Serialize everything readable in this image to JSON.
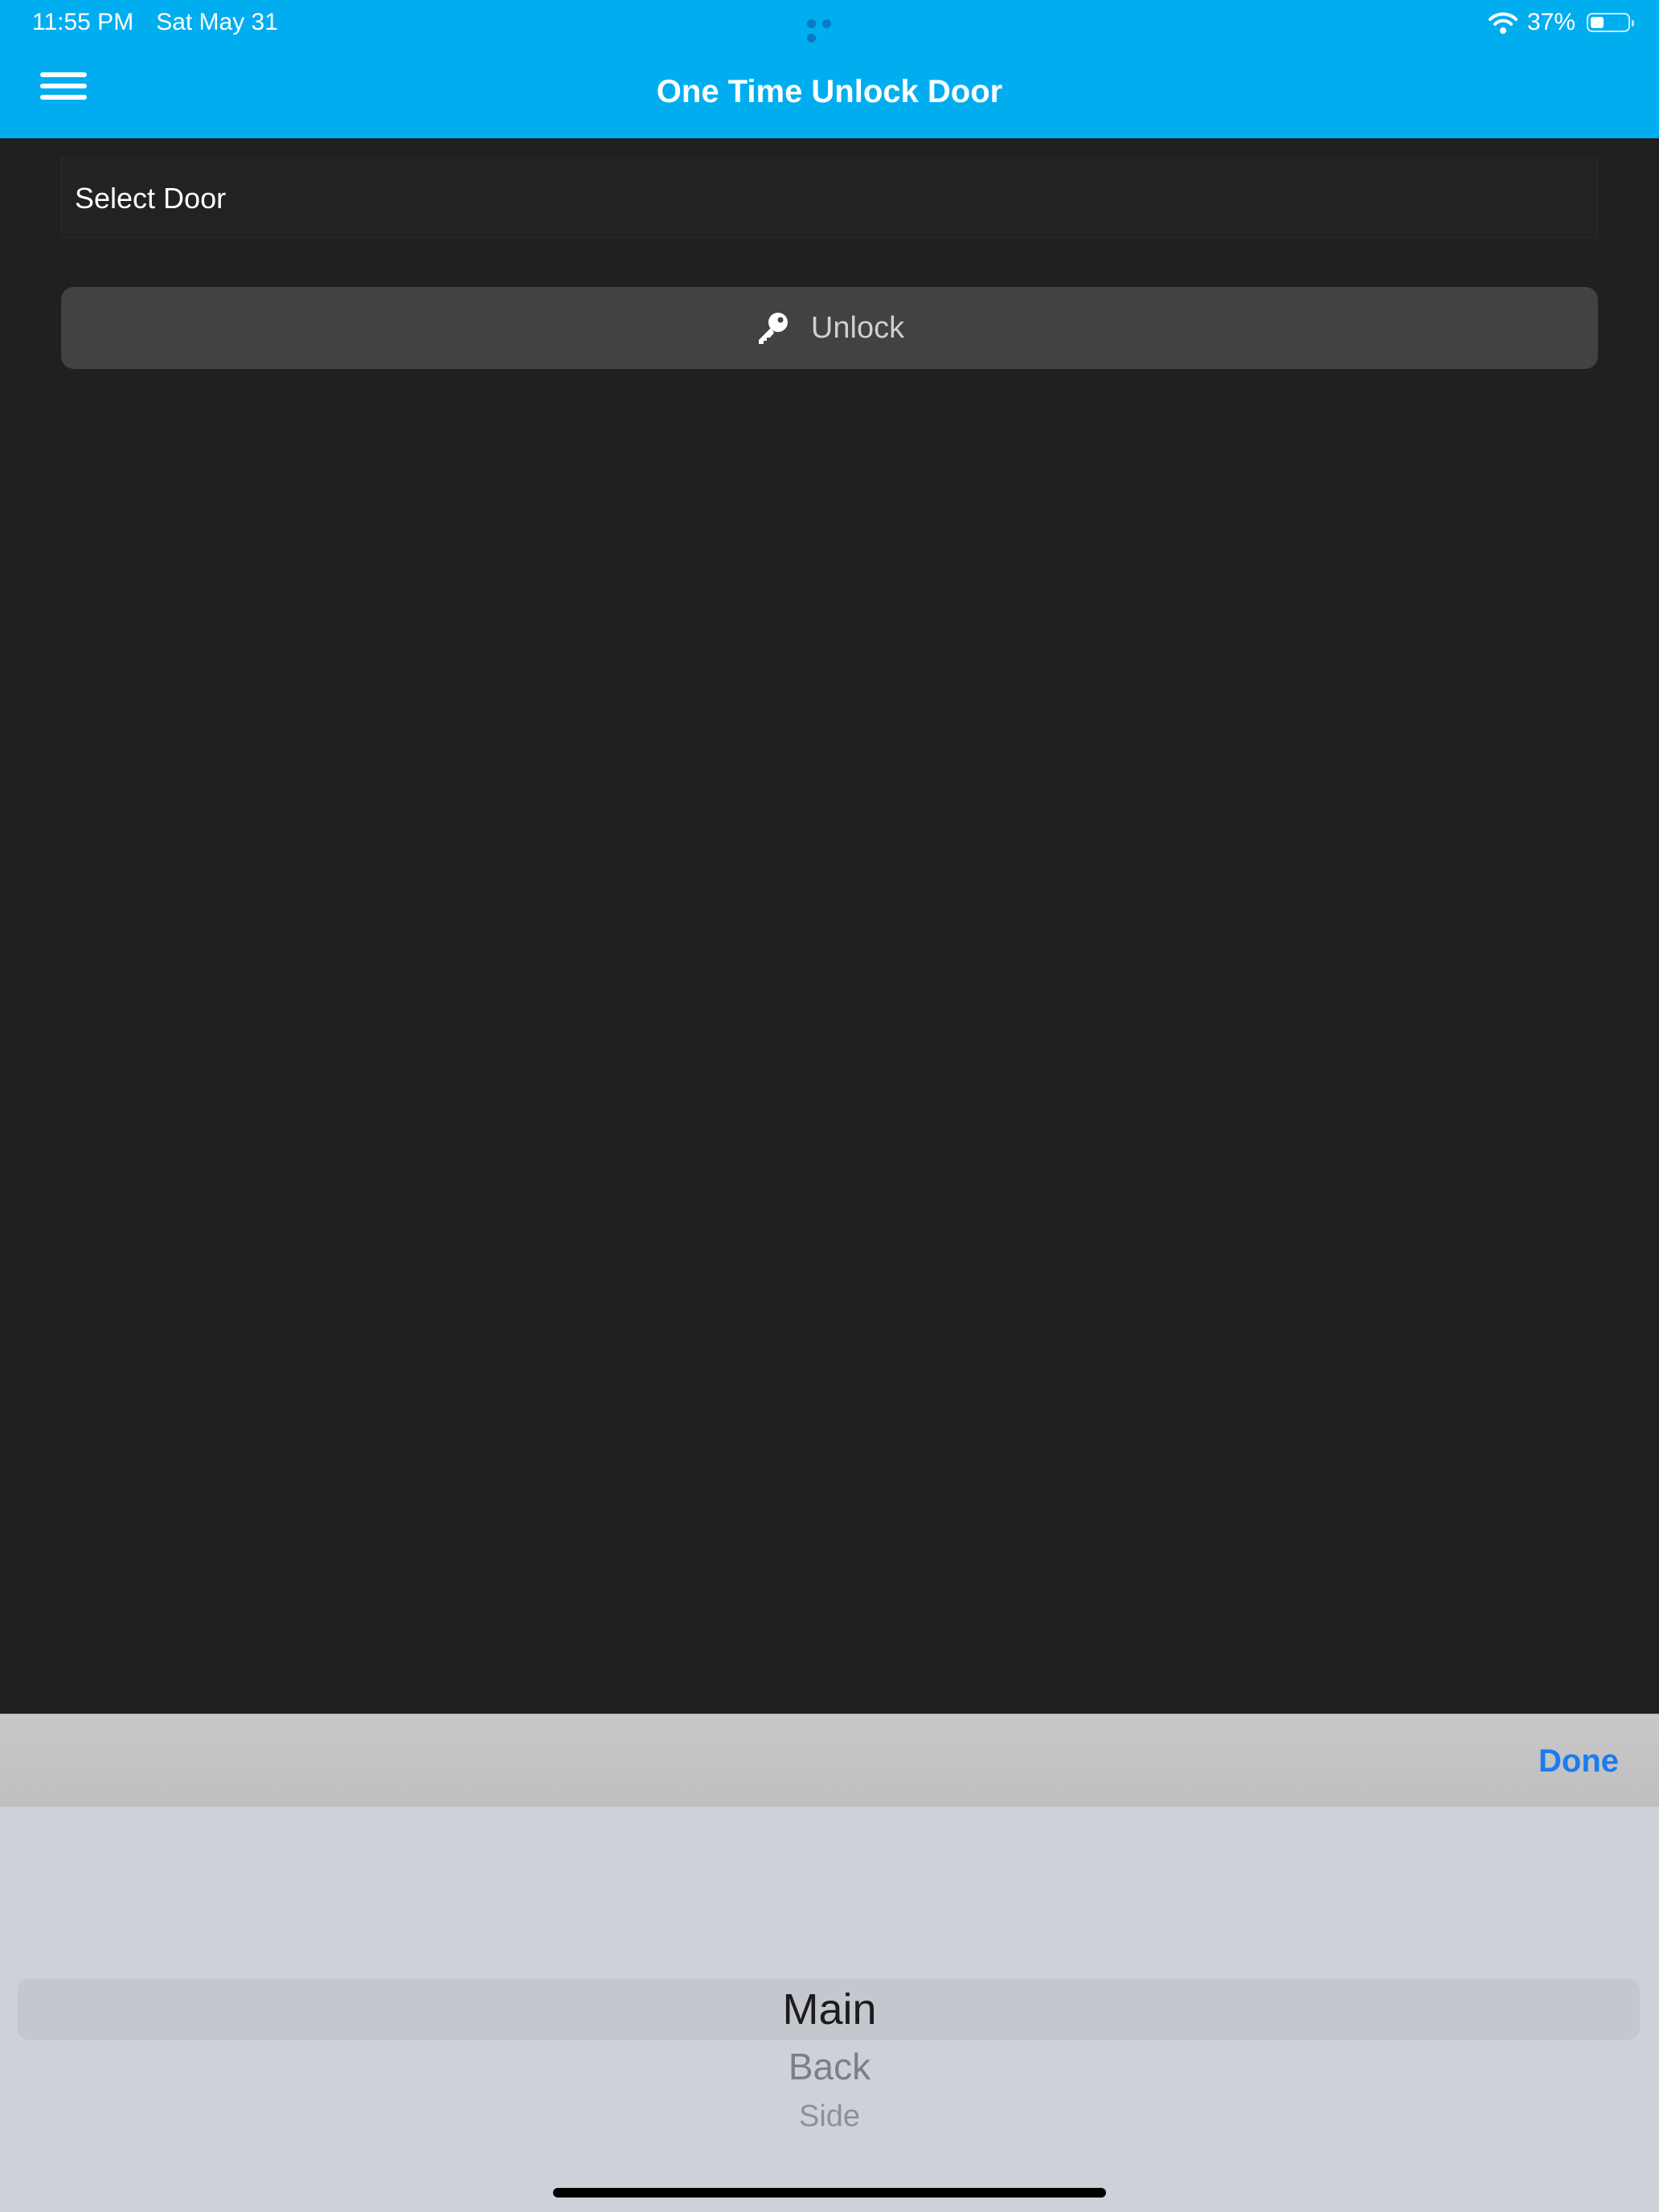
{
  "status_bar": {
    "time": "11:55 PM",
    "date": "Sat May 31",
    "battery_pct": "37%",
    "battery_level": 0.37,
    "icons": [
      "wifi-icon",
      "battery-icon",
      "more-dots-icon"
    ]
  },
  "header": {
    "title": "One Time Unlock Door",
    "menu_icon": "hamburger-menu-icon",
    "background_color": "#00aef0"
  },
  "form": {
    "select_door_label": "Select Door",
    "unlock_label": "Unlock",
    "unlock_icon": "key-icon"
  },
  "picker": {
    "done_label": "Done",
    "options": [
      "Main",
      "Back",
      "Side"
    ],
    "selected": "Main",
    "accent_color": "#1a7cf0"
  }
}
